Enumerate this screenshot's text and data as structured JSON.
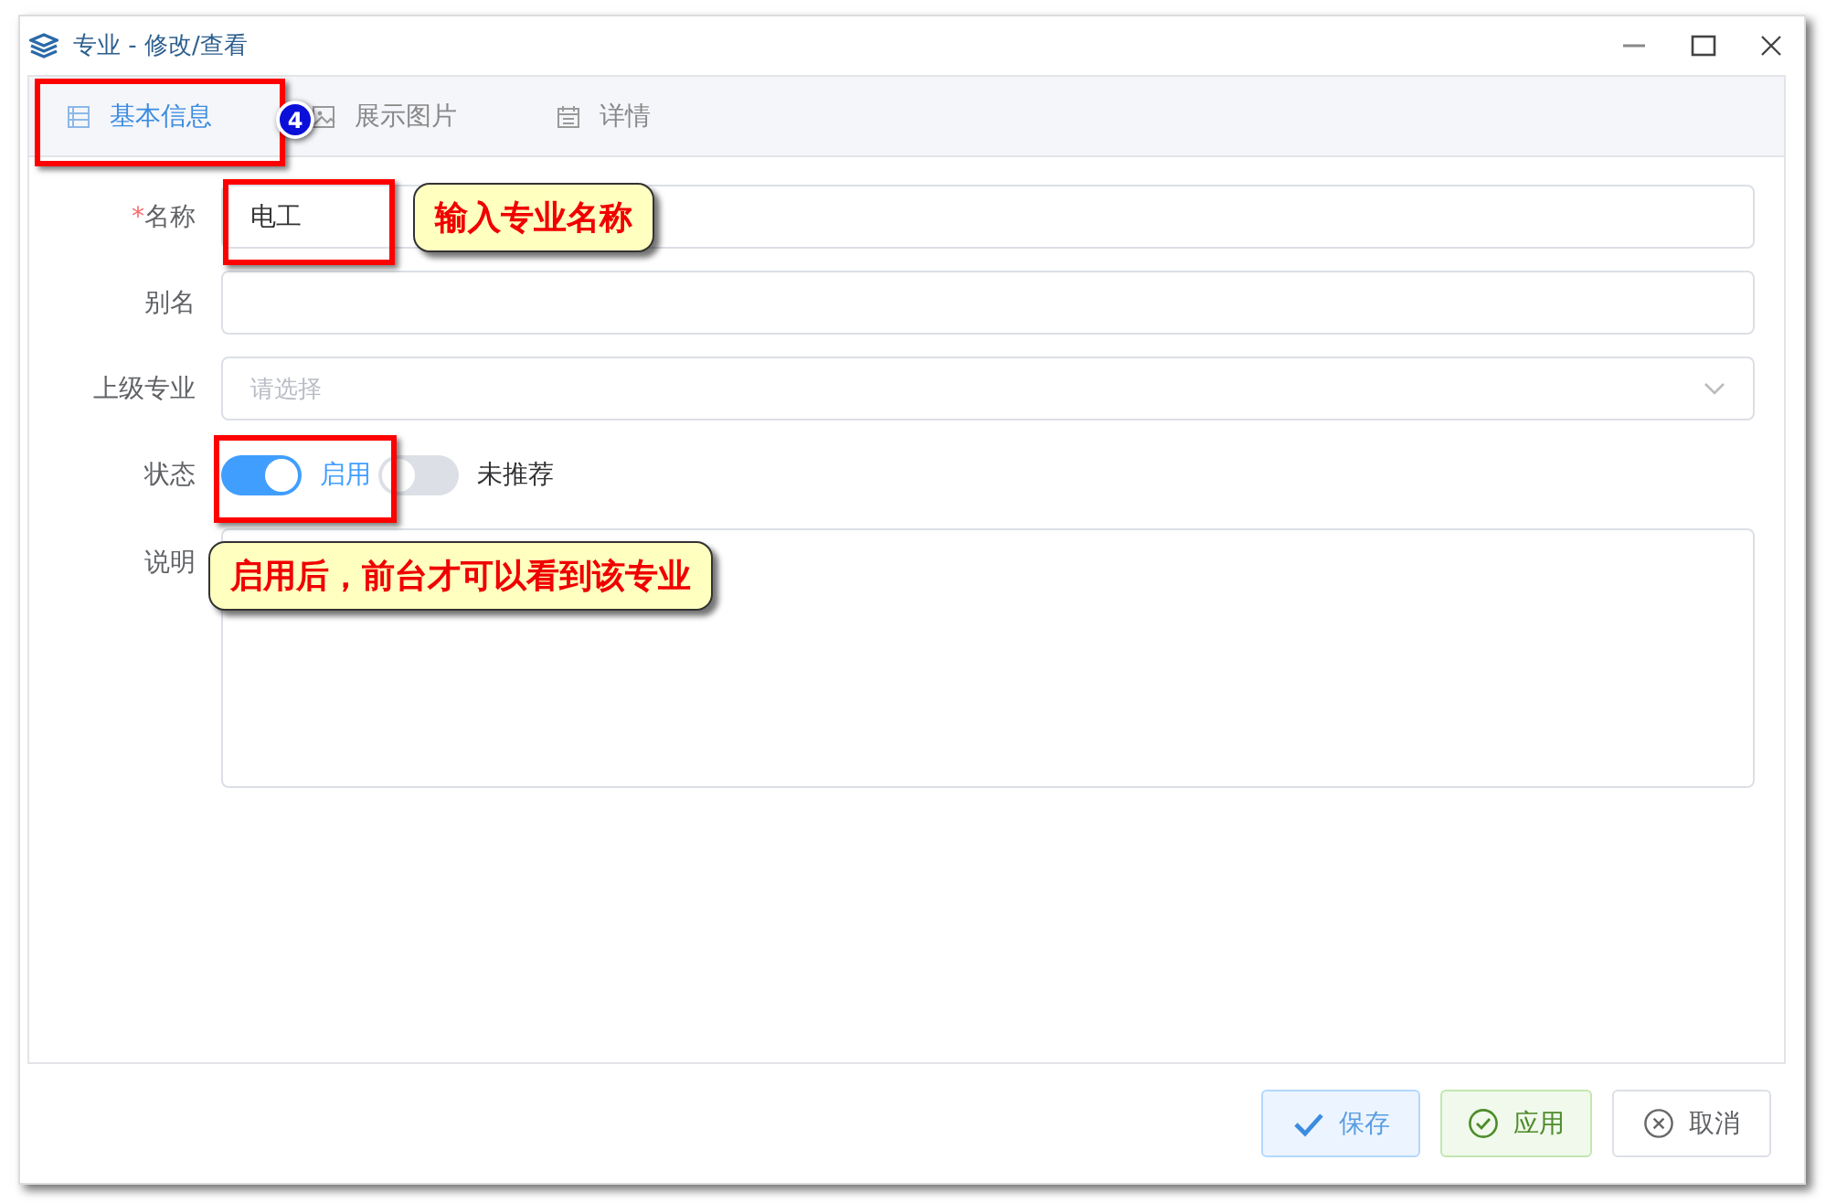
{
  "window": {
    "title": "专业 - 修改/查看"
  },
  "tabs": [
    {
      "label": "基本信息",
      "selected": true
    },
    {
      "label": "展示图片",
      "selected": false
    },
    {
      "label": "详情",
      "selected": false
    }
  ],
  "step_badge": "4",
  "form": [
    {
      "kind": "text",
      "label": "名称",
      "required_mark": "*",
      "value": "电工"
    },
    {
      "kind": "text",
      "label": "别名"
    },
    {
      "kind": "select",
      "label": "上级专业",
      "placeholder": "请选择"
    },
    {
      "kind": "switches",
      "label": "状态",
      "switches": [
        {
          "label": "启用",
          "on": true
        },
        {
          "label": "未推荐",
          "on": false
        }
      ]
    },
    {
      "kind": "textarea",
      "label": "说明"
    }
  ],
  "callouts": [
    "输入专业名称",
    "启用后，前台才可以看到该专业"
  ],
  "buttons": [
    {
      "label": "保存",
      "kind": "primary"
    },
    {
      "label": "应用",
      "kind": "success"
    },
    {
      "label": "取消",
      "kind": "default"
    }
  ]
}
